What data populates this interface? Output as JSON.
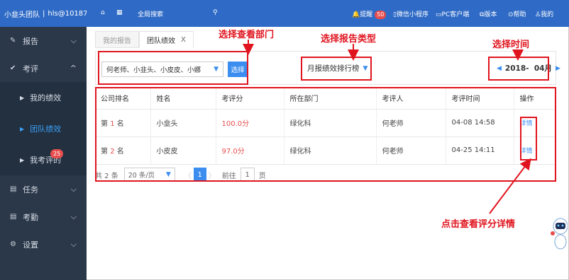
{
  "brand": {
    "team": "小韭头团队",
    "user": "hls@10187"
  },
  "sidebar": {
    "items": [
      {
        "icon": "edit-icon",
        "label": "报告"
      },
      {
        "icon": "check-icon",
        "label": "考评"
      },
      {
        "icon": "task-icon",
        "label": "任务"
      },
      {
        "icon": "attendance-icon",
        "label": "考勤"
      },
      {
        "icon": "gear-icon",
        "label": "设置"
      }
    ],
    "sub_items": [
      {
        "label": "我的绩效"
      },
      {
        "label": "团队绩效"
      },
      {
        "label": "我考评的",
        "badge": "25"
      }
    ]
  },
  "topbar": {
    "search_label": "全局搜索",
    "remind": "提醒",
    "remind_badge": "50",
    "wechat": "微信小程序",
    "pc": "PC客户端",
    "version": "版本",
    "help": "帮助",
    "me": "我的"
  },
  "tabs": [
    {
      "label": "我的报告"
    },
    {
      "label": "团队绩效",
      "close": "X"
    }
  ],
  "filter": {
    "dept_value": "何老师、小韭头、小皮皮、小娜",
    "select_button": "选择",
    "report_type": "月报绩效排行榜",
    "date_value": "2018-  04月"
  },
  "table": {
    "headers": [
      "公司排名",
      "姓名",
      "考评分",
      "所在部门",
      "考评人",
      "考评时间",
      "操作"
    ],
    "rows": [
      {
        "rank_prefix": "第",
        "rank": "1",
        "rank_suffix": "名",
        "name": "小韭头",
        "score": "100.0分",
        "dept": "绿化科",
        "reviewer": "何老师",
        "time": "04-08 14:58",
        "action": "详情"
      },
      {
        "rank_prefix": "第",
        "rank": "2",
        "rank_suffix": "名",
        "name": "小皮皮",
        "score": "97.0分",
        "dept": "绿化科",
        "reviewer": "何老师",
        "time": "04-25 14:11",
        "action": "详情"
      }
    ]
  },
  "pager": {
    "total": "共 2 条",
    "page_size": "20 条/页",
    "current": "1",
    "goto_prefix": "前往",
    "goto_value": "1",
    "goto_suffix": "页"
  },
  "annotations": {
    "dept": "选择查看部门",
    "type": "选择报告类型",
    "time": "选择时间",
    "detail": "点击查看评分详情"
  },
  "colors": {
    "accent": "#2f6bc6",
    "sidebar": "#2b3849",
    "annotation": "#e0141e",
    "highlight": "#e84d4d"
  }
}
